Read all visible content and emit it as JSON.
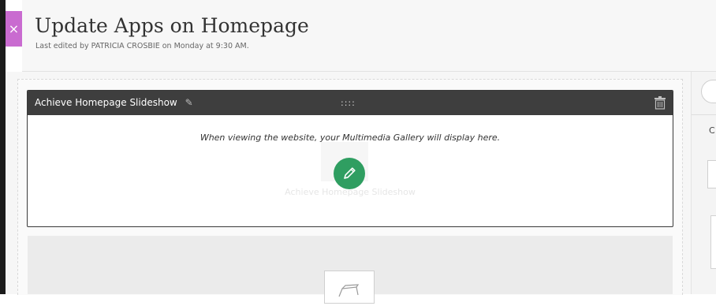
{
  "header": {
    "title": "Update Apps on Homepage",
    "last_edited": "Last edited by PATRICIA CROSBIE on Monday at 9:30 AM.",
    "close_glyph": "×"
  },
  "app_block": {
    "title": "Achieve Homepage Slideshow",
    "drag_glyph": "::::",
    "message": "When viewing the website, your Multimedia Gallery will display here.",
    "ghost_label": "Achieve Homepage Slideshow",
    "edit_icon": "pencil-icon"
  },
  "right_panel": {
    "label": "C"
  },
  "colors": {
    "close_accent": "#c96bd0",
    "app_bar": "#3e3e3e",
    "edit_button": "#2f9e61"
  }
}
